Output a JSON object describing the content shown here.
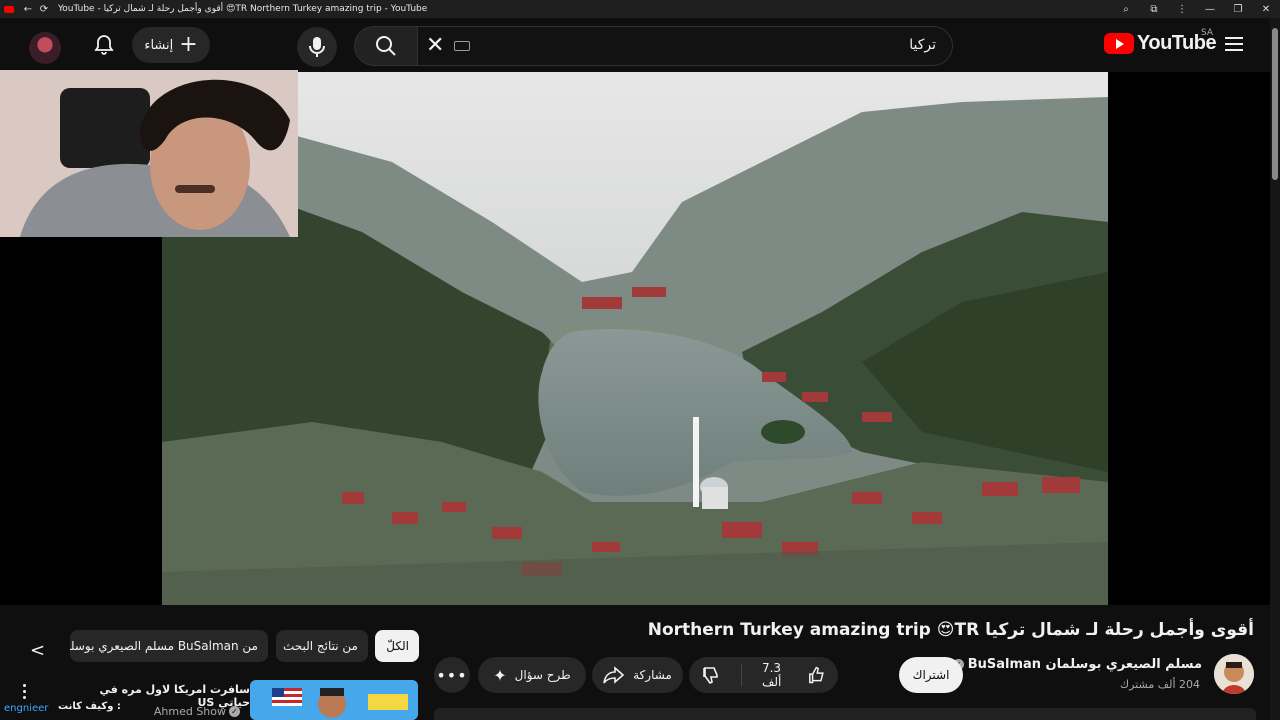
{
  "titlebar": {
    "tab_title": "YouTube - أقوى وأجمل رحلة لـ شمال تركيا 😍TR Northern Turkey amazing trip - YouTube"
  },
  "header": {
    "create_label": "إنشاء",
    "search_query": "تركيا",
    "logo_text": "YouTube",
    "region": "SA"
  },
  "video": {
    "title": "أقوى وأجمل رحلة لـ شمال تركيا Northern Turkey amazing trip 😍TR",
    "channel_name": "مسلم الصيعري بوسلمان BuSalman",
    "subscribers": "204 ألف مشترك",
    "subscribe_label": "اشتراك",
    "likes": "7.3 ألف",
    "share_label": "مشاركة",
    "ask_label": "طرح سؤال",
    "more_label": "•••"
  },
  "chips": [
    {
      "label": "الكلّ"
    },
    {
      "label": "من نتائج البحث"
    },
    {
      "label": "من BuSalman مسلم الصيعري بوسلمان"
    }
  ],
  "recommendation": {
    "title_line1": "سافرت امريكا لاول مره في حياتي US",
    "title_line2": "وكيف كانت :",
    "channel": "Ahmed Show"
  },
  "overlay": {
    "username": "engnieer"
  },
  "colors": {
    "brand_red": "#ff0000",
    "background": "#0f0f0f",
    "chip_bg": "#272727",
    "link_blue": "#3ea6ff"
  }
}
